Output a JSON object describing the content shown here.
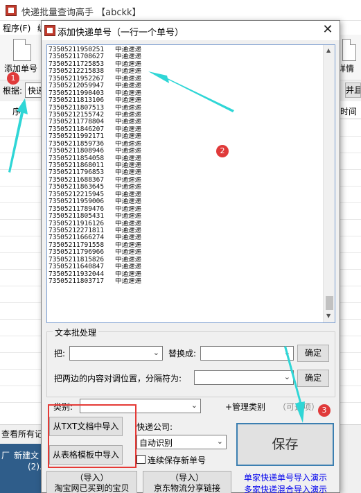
{
  "main_window": {
    "title": "快递批量查询高手 【abckk】",
    "menu": [
      "程序(F)",
      "编"
    ],
    "toolbar": {
      "add_label": "添加单号",
      "details_label": "详情"
    },
    "filter": {
      "label": "根据:",
      "select_value": "快递",
      "right_btn": "并且"
    },
    "grid_header": {
      "seq": "序",
      "time": "时间"
    },
    "status_text": "查看所有记",
    "taskbar": {
      "line1": "厂",
      "line2": "新建文",
      "line3": "(2)."
    }
  },
  "dialog": {
    "title": "添加快递单号（一行一个单号）",
    "close": "✕",
    "track_list": [
      {
        "no": "73505211950251",
        "carrier": "中通速递"
      },
      {
        "no": "73505211708627",
        "carrier": "中通速递"
      },
      {
        "no": "73505211725853",
        "carrier": "中通速递"
      },
      {
        "no": "73505212215838",
        "carrier": "中通速递"
      },
      {
        "no": "73505211952267",
        "carrier": "中通速递"
      },
      {
        "no": "73505212059947",
        "carrier": "中通速递"
      },
      {
        "no": "73505211990403",
        "carrier": "中通速递"
      },
      {
        "no": "73505211813106",
        "carrier": "中通速递"
      },
      {
        "no": "73505211807513",
        "carrier": "中通速递"
      },
      {
        "no": "73505212155742",
        "carrier": "中通速递"
      },
      {
        "no": "73505211778804",
        "carrier": "中通速递"
      },
      {
        "no": "73505211846207",
        "carrier": "中通速递"
      },
      {
        "no": "73505211992171",
        "carrier": "中通速递"
      },
      {
        "no": "73505211859736",
        "carrier": "中通速递"
      },
      {
        "no": "73505211808946",
        "carrier": "中通速递"
      },
      {
        "no": "73505211854058",
        "carrier": "中通速递"
      },
      {
        "no": "73505211868011",
        "carrier": "中通速递"
      },
      {
        "no": "73505211796853",
        "carrier": "中通速递"
      },
      {
        "no": "73505211688367",
        "carrier": "中通速递"
      },
      {
        "no": "73505211863645",
        "carrier": "中通速递"
      },
      {
        "no": "73505212215945",
        "carrier": "中通速递"
      },
      {
        "no": "73505211959006",
        "carrier": "中通速递"
      },
      {
        "no": "73505211789476",
        "carrier": "中通速递"
      },
      {
        "no": "73505211805431",
        "carrier": "中通速递"
      },
      {
        "no": "73505211916126",
        "carrier": "中通速递"
      },
      {
        "no": "73505212271811",
        "carrier": "中通速递"
      },
      {
        "no": "73505211666274",
        "carrier": "中通速递"
      },
      {
        "no": "73505211791558",
        "carrier": "中通速递"
      },
      {
        "no": "73505211796966",
        "carrier": "中通速递"
      },
      {
        "no": "73505211815826",
        "carrier": "中通速递"
      },
      {
        "no": "73505211640847",
        "carrier": "中通速递"
      },
      {
        "no": "73505211932044",
        "carrier": "中通速递"
      },
      {
        "no": "73505211803717",
        "carrier": "中通速递"
      }
    ],
    "batch": {
      "legend": "文本批处理",
      "replace_from_label": "把:",
      "replace_to_label": "替换成:",
      "confirm_1": "确定",
      "align_label": "把两边的内容对调位置，分隔符为:",
      "confirm_2": "确定"
    },
    "category_label": "类别:",
    "manage_category": "+管理类别",
    "optional_hint": "（可选项）",
    "import_txt": "从TXT文档中导入",
    "import_template": "从表格模板中导入",
    "courier_label": "快递公司:",
    "courier_value": "自动识别",
    "keep_label": "连续保存新单号",
    "save": "保存",
    "import_taobao_top": "（导入）",
    "import_taobao_bottom": "淘宝网已买到的宝贝",
    "import_jd_top": "（导入）",
    "import_jd_bottom": "京东物流分享链接",
    "link_single": "单家快递单号导入演示",
    "link_multi": "多家快递混合导入演示"
  },
  "annotations": {
    "badge1": "1",
    "badge2": "2",
    "badge3": "3",
    "arrow_color": "#2fd6d6",
    "badge_color": "#e03a3a",
    "box_color": "#e53935"
  }
}
